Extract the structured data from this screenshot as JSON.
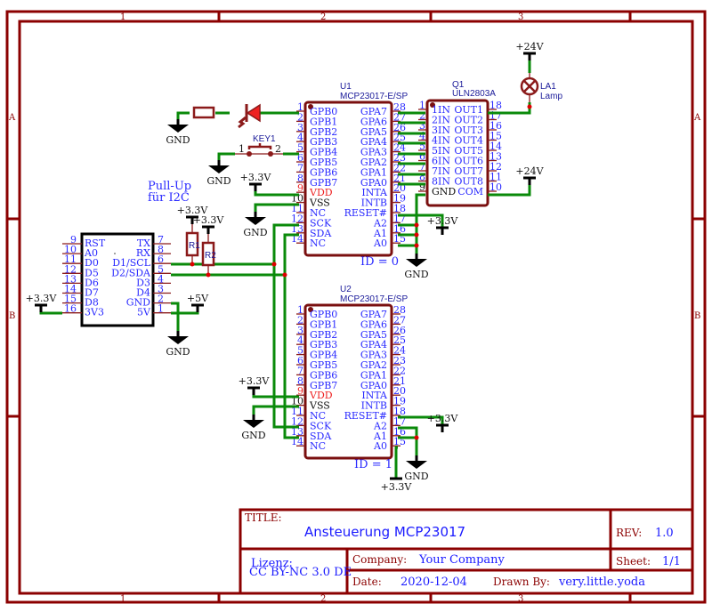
{
  "frame": {
    "col_zones": [
      "1",
      "2",
      "3"
    ],
    "row_zones": [
      "A",
      "B"
    ]
  },
  "titleblock": {
    "title_label": "TITLE:",
    "title": "Ansteuerung MCP23017",
    "rev_label": "REV:",
    "rev": "1.0",
    "license_label": "Lizenz:",
    "license": "CC BY-NC 3.0 DE",
    "company_label": "Company:",
    "company": "Your Company",
    "sheet_label": "Sheet:",
    "sheet": "1/1",
    "date_label": "Date:",
    "date": "2020-12-04",
    "drawn_label": "Drawn By:",
    "drawn_by": "very.little.yoda"
  },
  "u1": {
    "ref": "U1",
    "part": "MCP23017-E/SP",
    "id_label": "ID = 0",
    "left_pins": [
      {
        "num": "1",
        "name": "GPB0"
      },
      {
        "num": "2",
        "name": "GPB1"
      },
      {
        "num": "3",
        "name": "GPB2"
      },
      {
        "num": "4",
        "name": "GPB3"
      },
      {
        "num": "5",
        "name": "GPB4"
      },
      {
        "num": "6",
        "name": "GPB5"
      },
      {
        "num": "7",
        "name": "GPB6"
      },
      {
        "num": "8",
        "name": "GPB7"
      },
      {
        "num": "9",
        "name": "VDD"
      },
      {
        "num": "10",
        "name": "VSS"
      },
      {
        "num": "11",
        "name": "NC"
      },
      {
        "num": "12",
        "name": "SCK"
      },
      {
        "num": "13",
        "name": "SDA"
      },
      {
        "num": "14",
        "name": "NC"
      }
    ],
    "right_pins": [
      {
        "num": "28",
        "name": "GPA7"
      },
      {
        "num": "27",
        "name": "GPA6"
      },
      {
        "num": "26",
        "name": "GPA5"
      },
      {
        "num": "25",
        "name": "GPA4"
      },
      {
        "num": "24",
        "name": "GPA3"
      },
      {
        "num": "23",
        "name": "GPA2"
      },
      {
        "num": "22",
        "name": "GPA1"
      },
      {
        "num": "21",
        "name": "GPA0"
      },
      {
        "num": "20",
        "name": "INTA"
      },
      {
        "num": "19",
        "name": "INTB"
      },
      {
        "num": "18",
        "name": "RESET#"
      },
      {
        "num": "17",
        "name": "A2"
      },
      {
        "num": "16",
        "name": "A1"
      },
      {
        "num": "15",
        "name": "A0"
      }
    ]
  },
  "u2": {
    "ref": "U2",
    "part": "MCP23017-E/SP",
    "id_label": "ID = 1"
  },
  "q1": {
    "ref": "Q1",
    "part": "ULN2803A",
    "left_pins": [
      {
        "num": "1",
        "name": "1IN"
      },
      {
        "num": "2",
        "name": "2IN"
      },
      {
        "num": "3",
        "name": "3IN"
      },
      {
        "num": "4",
        "name": "4IN"
      },
      {
        "num": "5",
        "name": "5IN"
      },
      {
        "num": "6",
        "name": "6IN"
      },
      {
        "num": "7",
        "name": "7IN"
      },
      {
        "num": "8",
        "name": "8IN"
      },
      {
        "num": "9",
        "name": "GND"
      }
    ],
    "right_pins": [
      {
        "num": "18",
        "name": "OUT1"
      },
      {
        "num": "17",
        "name": "OUT2"
      },
      {
        "num": "16",
        "name": "OUT3"
      },
      {
        "num": "15",
        "name": "OUT4"
      },
      {
        "num": "14",
        "name": "OUT5"
      },
      {
        "num": "13",
        "name": "OUT6"
      },
      {
        "num": "12",
        "name": "OUT7"
      },
      {
        "num": "11",
        "name": "OUT8"
      },
      {
        "num": "10",
        "name": "COM"
      }
    ]
  },
  "esp": {
    "left_pins": [
      {
        "num": "9",
        "name": "RST"
      },
      {
        "num": "10",
        "name": "A0"
      },
      {
        "num": "11",
        "name": "D0"
      },
      {
        "num": "12",
        "name": "D5"
      },
      {
        "num": "13",
        "name": "D6"
      },
      {
        "num": "14",
        "name": "D7"
      },
      {
        "num": "15",
        "name": "D8"
      },
      {
        "num": "16",
        "name": "3V3"
      }
    ],
    "right_pins": [
      {
        "num": "7",
        "name": "TX"
      },
      {
        "num": "8",
        "name": "RX"
      },
      {
        "num": "6",
        "name": "D1/SCL"
      },
      {
        "num": "5",
        "name": "D2/SDA"
      },
      {
        "num": "4",
        "name": "D3"
      },
      {
        "num": "3",
        "name": "D4"
      },
      {
        "num": "2",
        "name": "GND"
      },
      {
        "num": "1",
        "name": "5V"
      }
    ]
  },
  "parts": {
    "lamp_ref": "LA1",
    "lamp_value": "Lamp",
    "key_ref": "KEY1",
    "key_pin1": "1",
    "key_pin2": "2",
    "r1": "R1",
    "r2": "R2"
  },
  "power": {
    "gnd": "GND",
    "v33": "+3.3V",
    "v5": "+5V",
    "v24": "+24V"
  },
  "notes": {
    "pullup_line1": "Pull-Up",
    "pullup_line2": "für I2C"
  }
}
